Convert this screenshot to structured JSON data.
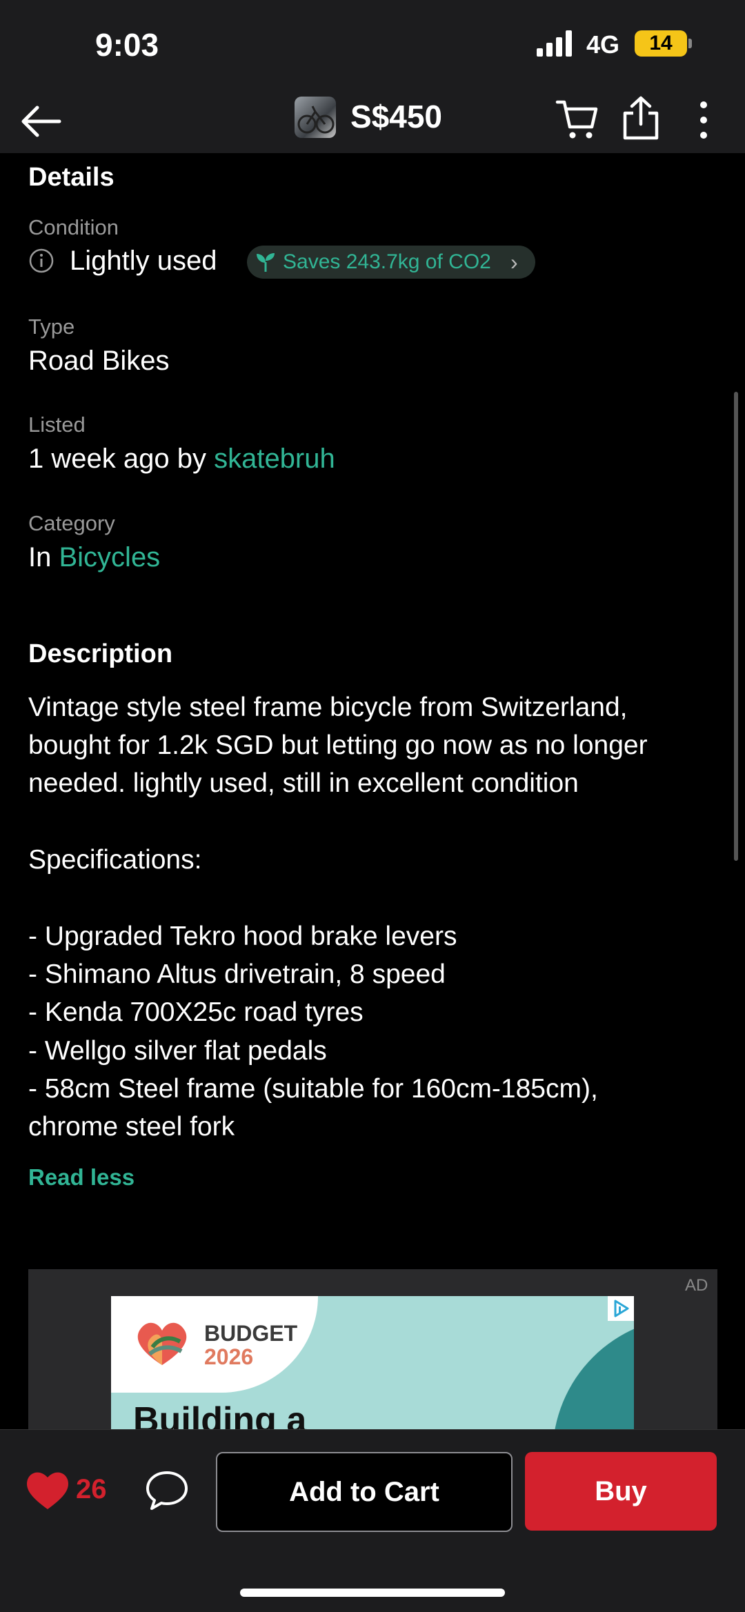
{
  "status_bar": {
    "time": "9:03",
    "network": "4G",
    "battery": "14"
  },
  "top_nav": {
    "price": "S$450"
  },
  "details": {
    "heading": "Details",
    "condition_label": "Condition",
    "condition_value": "Lightly used",
    "co2_badge": "Saves 243.7kg of CO2",
    "type_label": "Type",
    "type_value": "Road Bikes",
    "listed_label": "Listed",
    "listed_prefix": "1 week ago by",
    "listed_user": "skatebruh",
    "category_label": "Category",
    "category_prefix": "In",
    "category_value": "Bicycles"
  },
  "description": {
    "heading": "Description",
    "lines": [
      "Vintage style steel frame bicycle from Switzerland,",
      "bought for 1.2k SGD but letting go now as no longer",
      "needed. lightly used, still in excellent condition",
      "Specifications:",
      "- Upgraded Tekro hood brake levers",
      "- Shimano Altus drivetrain, 8 speed",
      "- Kenda 700X25c road tyres",
      "- Wellgo silver flat pedals",
      "- 58cm Steel frame (suitable for 160cm-185cm),",
      "chrome steel fork"
    ],
    "read_less": "Read less"
  },
  "ad": {
    "tag": "AD",
    "brand_line1": "BUDGET",
    "brand_line2": "2026",
    "headline": "Building a"
  },
  "bottom_bar": {
    "like_count": "26",
    "add_to_cart": "Add to Cart",
    "buy": "Buy"
  },
  "colors": {
    "accent": "#31b595",
    "buy": "#d3212d",
    "bar_bg": "#1c1c1e"
  },
  "icons": [
    "back-arrow-icon",
    "cart-icon",
    "share-icon",
    "more-icon",
    "info-icon",
    "leaf-icon",
    "chevron-right-icon",
    "heart-icon",
    "chat-bubble-icon",
    "ad-choices-icon"
  ]
}
